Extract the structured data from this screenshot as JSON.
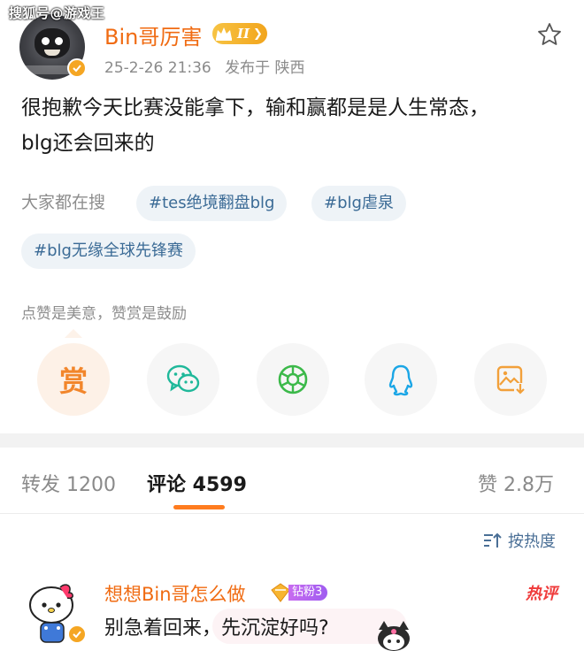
{
  "watermark": "搜狐号@游戏王",
  "post": {
    "author": "Bin哥厉害",
    "level_badge": "II",
    "date": "25-2-26 21:36",
    "location": "发布于 陕西",
    "content_line1": "很抱歉今天比赛没能拿下，输和赢都是是人生常态，",
    "content_line2": "blg还会回来的"
  },
  "search": {
    "label": "大家都在搜",
    "tags": [
      "#tes绝境翻盘blg",
      "#blg虐泉",
      "#blg无缘全球先锋赛"
    ]
  },
  "reward": {
    "hint": "点赞是美意，赞赏是鼓励",
    "button_glyph": "赏"
  },
  "share_icons": [
    "reward-icon",
    "wechat-icon",
    "moments-icon",
    "qq-icon",
    "save-image-icon"
  ],
  "tabs": {
    "repost": "转发 1200",
    "comments": "评论 4599",
    "likes": "赞 2.8万"
  },
  "sort": {
    "label": "按热度"
  },
  "comment": {
    "author": "想想Bin哥怎么做",
    "fan_badge": "钻粉3",
    "hot_label": "热评",
    "text": "别急着回来，先沉淀好吗?"
  },
  "colors": {
    "accent_orange": "#f06b12",
    "link_blue": "#3b6b96",
    "tab_underline": "#ff7c1f",
    "hot_red": "#ef3b3b"
  }
}
